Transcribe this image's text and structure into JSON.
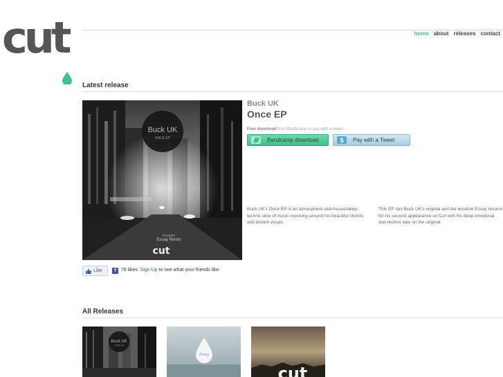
{
  "logo": {
    "text": "cut",
    "accent_color": "#3ec28f"
  },
  "nav": {
    "items": [
      {
        "label": "home",
        "active": true
      },
      {
        "label": "about",
        "active": false
      },
      {
        "label": "releases",
        "active": false
      },
      {
        "label": "contact",
        "active": false
      }
    ]
  },
  "latest": {
    "heading": "Latest release",
    "artist": "Buck UK",
    "title": "Once EP",
    "cover": {
      "circle_title": "Buck UK",
      "circle_sub": "ONCE EP",
      "includes": "Includes",
      "remix": "Essay Remix",
      "logo": "cut"
    },
    "free_bold": "Free download",
    "free_rest": " from Bandcamp or pay with a tweet...",
    "bandcamp_label": "Bandcamp download",
    "bandcamp_icon": "bandcamp-icon",
    "tweet_label": "Pay with a Tweet",
    "tweet_icon": "dollar-icon",
    "tweet_icon_glyph": "$",
    "desc1": "Buck UK's Once EP is an atmospheric dub-house/deep-techno slice of music revolving around his beautiful chords and distant vocals.",
    "desc2": "This EP has Buck UK's original and the emotive Essay returns for his second appearance on Cut with his deep emotional dub-techno take on the original."
  },
  "like": {
    "button_label": "Like",
    "fb_glyph": "f",
    "count_text": "78 likes.",
    "signup_label": "Sign Up",
    "rest_text": "to see what your friends like."
  },
  "all_releases": {
    "heading": "All Releases",
    "items": [
      {
        "circle_title": "Buck UK",
        "circle_sub": "ONCE EP"
      },
      {
        "drop_text": "Essay"
      },
      {
        "logo": "cut"
      }
    ]
  }
}
